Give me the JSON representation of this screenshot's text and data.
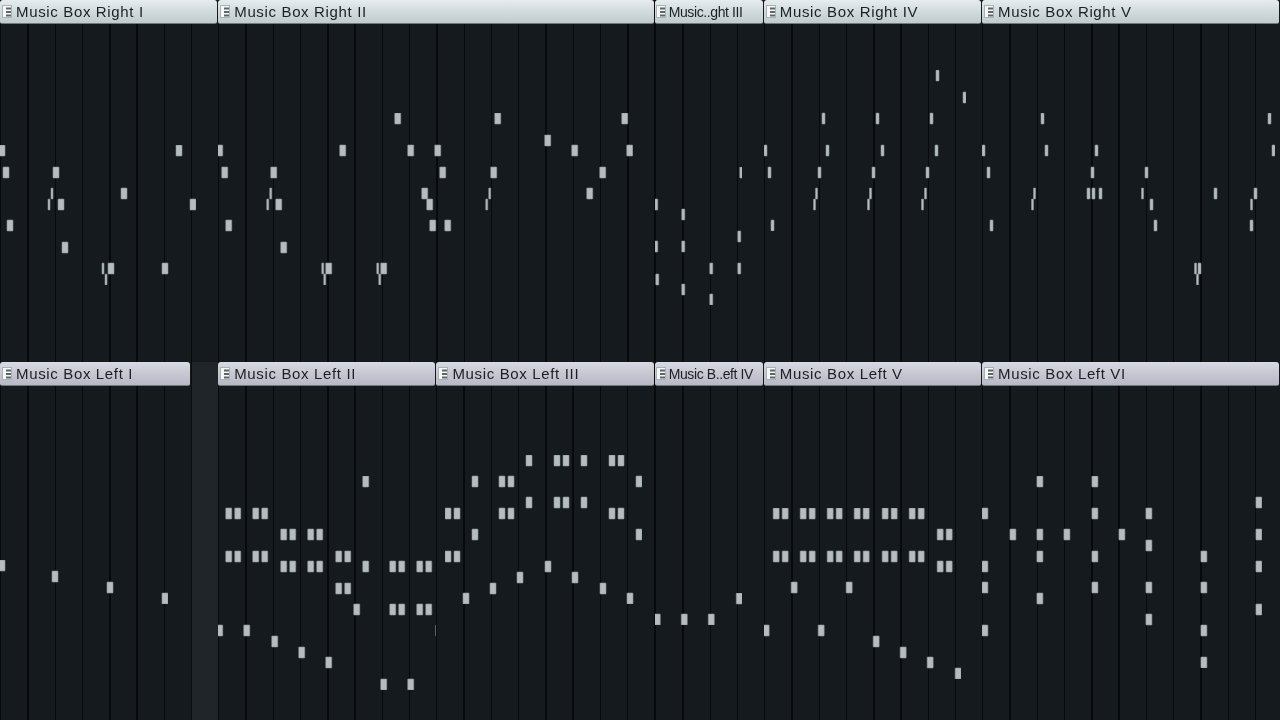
{
  "playlist": {
    "tracks": [
      {
        "clips": [
          {
            "title": "Music Box Right I"
          },
          {
            "title": "Music Box Right II"
          },
          {
            "title": "Music..ght III"
          },
          {
            "title": "Music Box Right IV"
          },
          {
            "title": "Music Box Right V"
          }
        ]
      },
      {
        "clips": [
          {
            "title": "Music Box Left I"
          },
          {
            "title": "Music Box Left II"
          },
          {
            "title": "Music Box Left III"
          },
          {
            "title": "Music B..eft IV"
          },
          {
            "title": "Music Box Left V"
          },
          {
            "title": "Music Box Left VI"
          }
        ]
      }
    ]
  }
}
